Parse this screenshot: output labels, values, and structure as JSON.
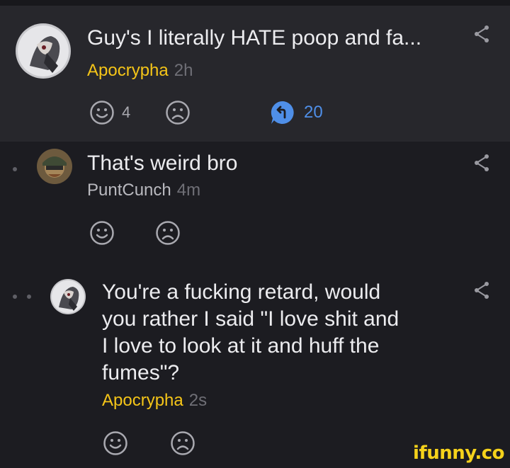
{
  "comments": [
    {
      "text_lines": [
        "Guy's I literally HATE poop and fa..."
      ],
      "author": "Apocrypha",
      "time": "2h",
      "reactions": {
        "like_count": "4",
        "dislike_count": ""
      },
      "replies_count": "20",
      "author_color": "#f5c518"
    },
    {
      "text_lines": [
        "That's weird bro"
      ],
      "author": "PuntCunch",
      "time": "4m",
      "reactions": {
        "like_count": "",
        "dislike_count": ""
      },
      "author_color": "#b9b9bf"
    },
    {
      "text_lines": [
        "You're a fucking retard, would",
        "you rather I said \"I love shit and",
        "I love to look at it and huff the",
        "fumes\"?"
      ],
      "author": "Apocrypha",
      "time": "2s",
      "reactions": {
        "like_count": "",
        "dislike_count": ""
      },
      "author_color": "#f5c518"
    }
  ],
  "icons": {
    "share": "share-icon",
    "like": "smiley-icon",
    "dislike": "sad-face-icon",
    "reply": "reply-bubble-icon"
  },
  "watermark": "ifunny.co",
  "colors": {
    "background": "#1c1c21",
    "highlight_background": "#27272c",
    "reply_accent": "#4f8fe8"
  }
}
